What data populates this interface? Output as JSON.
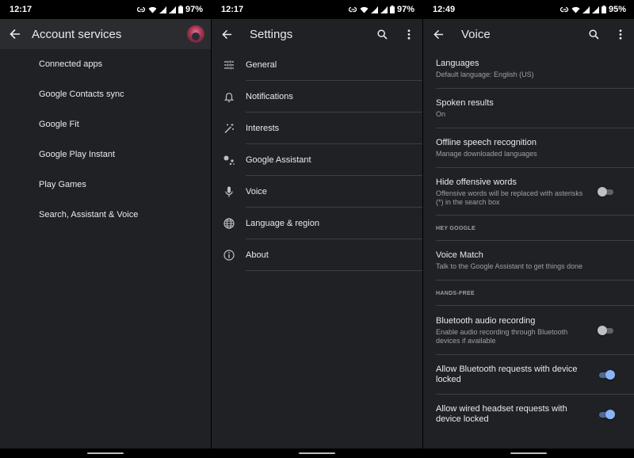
{
  "panels": [
    {
      "status": {
        "time": "12:17",
        "battery": "97%"
      },
      "appbar": {
        "title": "Account services"
      },
      "items": [
        "Connected apps",
        "Google Contacts sync",
        "Google Fit",
        "Google Play Instant",
        "Play Games",
        "Search, Assistant & Voice"
      ]
    },
    {
      "status": {
        "time": "12:17",
        "battery": "97%"
      },
      "appbar": {
        "title": "Settings"
      },
      "items": [
        {
          "label": "General",
          "icon": "sliders-icon"
        },
        {
          "label": "Notifications",
          "icon": "bell-icon"
        },
        {
          "label": "Interests",
          "icon": "magic-wand-icon"
        },
        {
          "label": "Google Assistant",
          "icon": "assistant-icon"
        },
        {
          "label": "Voice",
          "icon": "microphone-icon"
        },
        {
          "label": "Language & region",
          "icon": "globe-icon"
        },
        {
          "label": "About",
          "icon": "info-icon"
        }
      ]
    },
    {
      "status": {
        "time": "12:49",
        "battery": "95%"
      },
      "appbar": {
        "title": "Voice"
      },
      "items": [
        {
          "title": "Languages",
          "subtitle": "Default language: English (US)"
        },
        {
          "title": "Spoken results",
          "subtitle": "On"
        },
        {
          "title": "Offline speech recognition",
          "subtitle": "Manage downloaded languages"
        },
        {
          "title": "Hide offensive words",
          "subtitle": "Offensive words will be replaced with asterisks (*) in the search box",
          "toggle": false
        },
        {
          "section": "HEY GOOGLE"
        },
        {
          "title": "Voice Match",
          "subtitle": "Talk to the Google Assistant to get things done"
        },
        {
          "section": "HANDS-FREE"
        },
        {
          "title": "Bluetooth audio recording",
          "subtitle": "Enable audio recording through Bluetooth devices if available",
          "toggle": false
        },
        {
          "title": "Allow Bluetooth requests with device locked",
          "toggle": true
        },
        {
          "title": "Allow wired headset requests with device locked",
          "toggle": true
        }
      ]
    }
  ]
}
